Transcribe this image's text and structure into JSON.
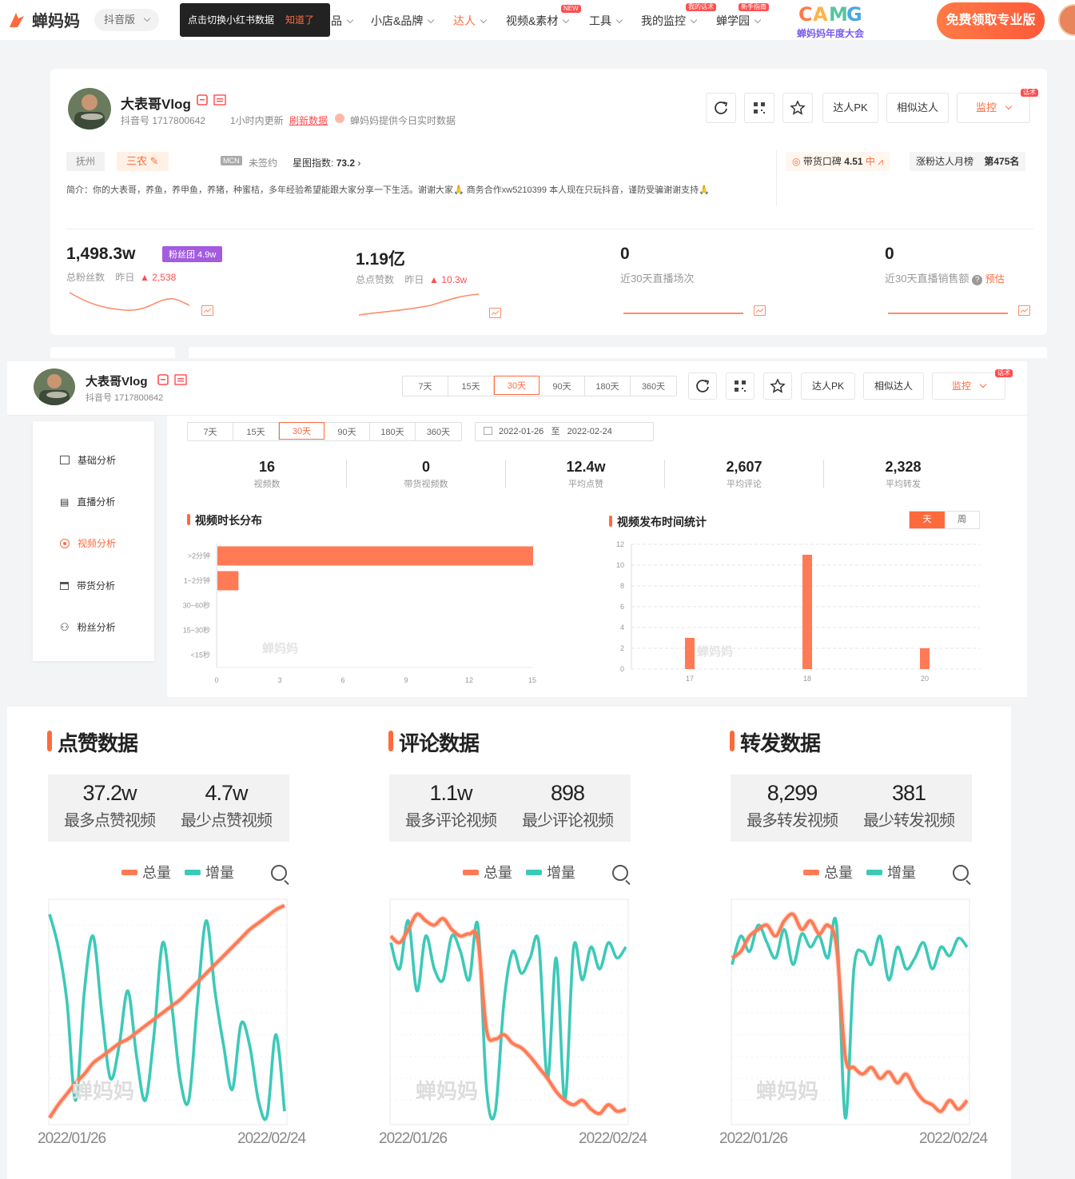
{
  "nav": {
    "logo": "蝉妈妈",
    "version": "抖音版",
    "tip_text": "点击切换小红书数据",
    "tip_action": "知道了",
    "items": [
      {
        "label": "品"
      },
      {
        "label": "小店&品牌"
      },
      {
        "label": "达人",
        "active": true
      },
      {
        "label": "视频&素材",
        "badge": "NEW"
      },
      {
        "label": "工具"
      },
      {
        "label": "我的监控",
        "badge": "我的话术"
      },
      {
        "label": "蝉学园",
        "badge": "新手指南"
      }
    ],
    "event_logo": "蝉妈妈年度大会",
    "pro_button": "免费领取专业版"
  },
  "profile": {
    "name": "大表哥Vlog",
    "douyin_id": "抖音号 1717800642",
    "updated": "1小时内更新",
    "refresh": "刷新数据",
    "realtime": "蝉妈妈提供今日实时数据",
    "location": "抚州",
    "category": "三农",
    "mcn": "MCN",
    "mcn_status": "未签约",
    "star_index_label": "星图指数:",
    "star_index": "73.2",
    "reputation_label": "带货口碑",
    "reputation_value": "4.51",
    "reputation_level": "中",
    "rank_label": "涨粉达人月榜",
    "rank_value": "第475名",
    "bio": "简介：你的大表哥，养鱼，养甲鱼，养猪，种蜜桔，多年经验希望能跟大家分享一下生活。谢谢大家🙏 商务合作xw5210399 本人现在只玩抖音，谨防受骗谢谢支持🙏",
    "buttons": {
      "pk": "达人PK",
      "similar": "相似达人",
      "monitor": "监控",
      "monitor_badge": "话术"
    }
  },
  "stats": [
    {
      "value": "1,498.3w",
      "label": "总粉丝数",
      "yesterday": "昨日",
      "change": "2,538",
      "chip": "粉丝团 4.9w"
    },
    {
      "value": "1.19亿",
      "label": "总点赞数",
      "yesterday": "昨日",
      "change": "10.3w"
    },
    {
      "value": "0",
      "label": "近30天直播场次"
    },
    {
      "value": "0",
      "label": "近30天直播销售额",
      "extra": "预估"
    }
  ],
  "section2": {
    "name": "大表哥Vlog",
    "douyin_id": "抖音号 1717800642",
    "ranges": [
      "7天",
      "15天",
      "30天",
      "90天",
      "180天",
      "360天"
    ],
    "active_range": "30天",
    "date_from": "2022-01-26",
    "date_sep": "至",
    "date_to": "2022-02-24",
    "sidenav": [
      "基础分析",
      "直播分析",
      "视频分析",
      "带货分析",
      "粉丝分析"
    ],
    "kpis": [
      {
        "value": "16",
        "label": "视频数"
      },
      {
        "value": "0",
        "label": "带货视频数"
      },
      {
        "value": "12.4w",
        "label": "平均点赞"
      },
      {
        "value": "2,607",
        "label": "平均评论"
      },
      {
        "value": "2,328",
        "label": "平均转发"
      }
    ],
    "duration_title": "视频时长分布",
    "publish_title": "视频发布时间统计",
    "toggle": [
      "天",
      "周"
    ],
    "watermark": "蝉妈妈"
  },
  "chart_data": [
    {
      "type": "bar",
      "orientation": "horizontal",
      "title": "视频时长分布",
      "categories": [
        ">2分钟",
        "1~2分钟",
        "30~60秒",
        "15~30秒",
        "<15秒"
      ],
      "values": [
        15,
        1,
        0,
        0,
        0
      ],
      "xticks": [
        "0",
        "3",
        "6",
        "9",
        "12",
        "15"
      ],
      "xlim": [
        0,
        15
      ],
      "color": "#ff7a55"
    },
    {
      "type": "bar",
      "title": "视频发布时间统计",
      "categories": [
        "17",
        "18",
        "20"
      ],
      "values": [
        3,
        11,
        2
      ],
      "yticks": [
        "0",
        "2",
        "4",
        "6",
        "8",
        "10",
        "12"
      ],
      "ylim": [
        0,
        12
      ],
      "color": "#ff7a55"
    },
    {
      "type": "line",
      "title": "点赞数据",
      "series": [
        {
          "name": "总量",
          "color": "#ff7a55",
          "values": [
            0.02,
            0.08,
            0.13,
            0.18,
            0.22,
            0.27,
            0.3,
            0.33,
            0.36,
            0.38,
            0.41,
            0.44,
            0.47,
            0.5,
            0.53,
            0.56,
            0.6,
            0.64,
            0.68,
            0.72,
            0.76,
            0.8,
            0.84,
            0.88,
            0.91,
            0.94,
            0.97,
            0.99
          ]
        },
        {
          "name": "增量",
          "color": "#3cc9b8",
          "values": [
            0.95,
            0.8,
            0.55,
            0.1,
            0.6,
            0.85,
            0.5,
            0.2,
            0.35,
            0.6,
            0.3,
            0.1,
            0.4,
            0.82,
            0.55,
            0.2,
            0.1,
            0.55,
            0.92,
            0.6,
            0.35,
            0.15,
            0.45,
            0.35,
            0.1,
            0.03,
            0.4,
            0.05
          ]
        }
      ]
    },
    {
      "type": "line",
      "title": "评论数据",
      "series": [
        {
          "name": "总量",
          "color": "#ff7a55",
          "values": [
            0.85,
            0.82,
            0.88,
            0.95,
            0.92,
            0.9,
            0.93,
            0.88,
            0.85,
            0.86,
            0.83,
            0.42,
            0.38,
            0.4,
            0.36,
            0.34,
            0.3,
            0.25,
            0.2,
            0.14,
            0.1,
            0.08,
            0.1,
            0.06,
            0.04,
            0.08,
            0.05,
            0.06
          ]
        },
        {
          "name": "增量",
          "color": "#3cc9b8",
          "values": [
            0.82,
            0.7,
            0.92,
            0.6,
            0.85,
            0.7,
            0.65,
            0.85,
            0.78,
            0.65,
            0.9,
            0.15,
            0.05,
            0.55,
            0.78,
            0.68,
            0.75,
            0.82,
            0.2,
            0.75,
            0.1,
            0.8,
            0.65,
            0.8,
            0.7,
            0.82,
            0.75,
            0.8
          ]
        }
      ]
    },
    {
      "type": "line",
      "title": "转发数据",
      "series": [
        {
          "name": "总量",
          "color": "#ff7a55",
          "values": [
            0.75,
            0.78,
            0.85,
            0.88,
            0.9,
            0.85,
            0.92,
            0.95,
            0.88,
            0.92,
            0.86,
            0.9,
            0.8,
            0.3,
            0.25,
            0.22,
            0.25,
            0.2,
            0.23,
            0.18,
            0.22,
            0.15,
            0.1,
            0.08,
            0.05,
            0.1,
            0.06,
            0.1
          ]
        },
        {
          "name": "增量",
          "color": "#3cc9b8",
          "values": [
            0.72,
            0.85,
            0.78,
            0.9,
            0.82,
            0.75,
            0.88,
            0.72,
            0.86,
            0.8,
            0.85,
            0.75,
            0.9,
            0.02,
            0.7,
            0.78,
            0.72,
            0.85,
            0.65,
            0.8,
            0.7,
            0.75,
            0.82,
            0.7,
            0.8,
            0.76,
            0.84,
            0.8
          ]
        }
      ]
    }
  ],
  "section3": {
    "panels": [
      {
        "title": "点赞数据",
        "max_value": "37.2w",
        "max_label": "最多点赞视频",
        "min_value": "4.7w",
        "min_label": "最少点赞视频"
      },
      {
        "title": "评论数据",
        "max_value": "1.1w",
        "max_label": "最多评论视频",
        "min_value": "898",
        "min_label": "最少评论视频"
      },
      {
        "title": "转发数据",
        "max_value": "8,299",
        "max_label": "最多转发视频",
        "min_value": "381",
        "min_label": "最少转发视频"
      }
    ],
    "legend_total": "总量",
    "legend_delta": "增量",
    "date_start": "2022/01/26",
    "date_end": "2022/02/24",
    "watermark": "蝉妈妈"
  },
  "colors": {
    "accent": "#ff6a3d",
    "teal": "#3cc9b8",
    "coral": "#ff7a55"
  }
}
